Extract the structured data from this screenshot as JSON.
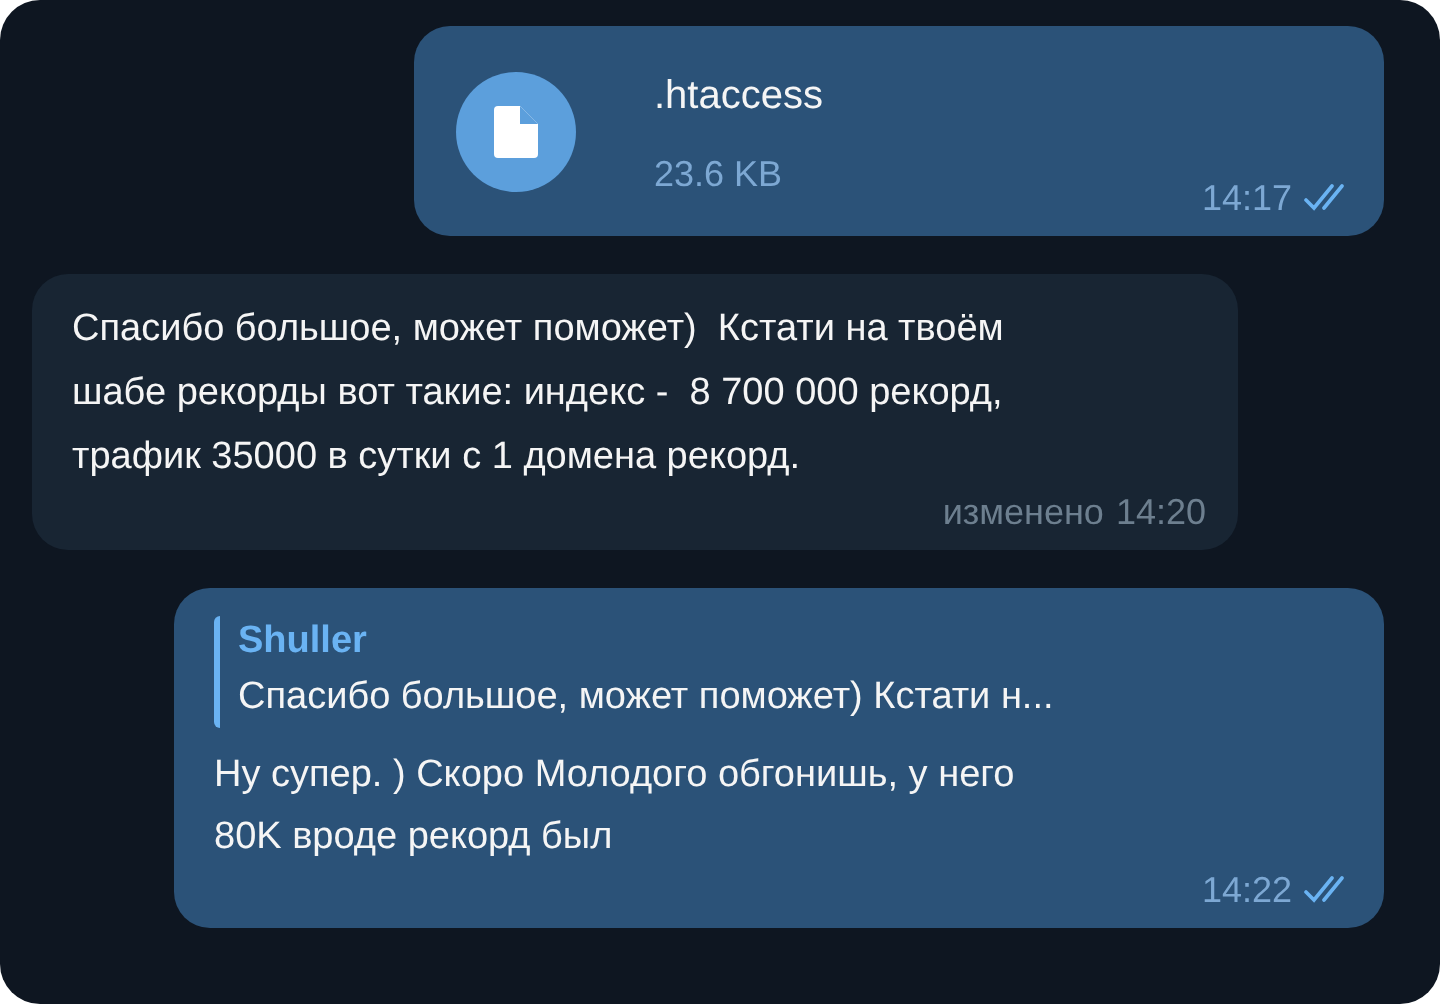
{
  "messages": [
    {
      "kind": "file",
      "outgoing": true,
      "file_name": ".htaccess",
      "file_size": "23.6 KB",
      "time": "14:17",
      "read": true
    },
    {
      "kind": "text",
      "outgoing": false,
      "text": "Спасибо большое, может поможет)  Кстати на твоём шабе рекорды вот такие: индекс -  8 700 000 рекорд, трафик 35000 в сутки с 1 домена рекорд.",
      "edited": "изменено",
      "time": "14:20"
    },
    {
      "kind": "reply",
      "outgoing": true,
      "reply_author": "Shuller",
      "reply_text": "Спасибо большое, может поможет)  Кстати н...",
      "text": "Ну супер. ) Скоро Молодого обгонишь, у него 80K вроде рекорд был",
      "time": "14:22",
      "read": true
    }
  ]
}
